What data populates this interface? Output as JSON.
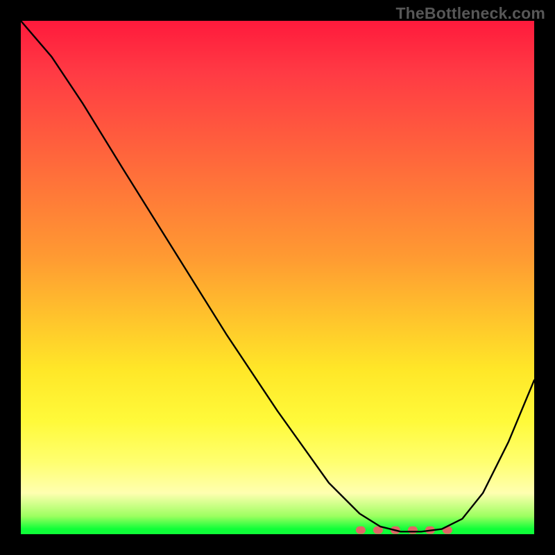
{
  "watermark": "TheBottleneck.com",
  "chart_data": {
    "type": "line",
    "title": "",
    "xlabel": "",
    "ylabel": "",
    "xlim": [
      0,
      100
    ],
    "ylim": [
      0,
      100
    ],
    "grid": false,
    "legend": false,
    "series": [
      {
        "name": "bottleneck-curve",
        "x": [
          0,
          6,
          12,
          20,
          30,
          40,
          50,
          60,
          66,
          70,
          74,
          78,
          82,
          86,
          90,
          95,
          100
        ],
        "values": [
          100,
          93,
          84,
          71,
          55,
          39,
          24,
          10,
          4,
          1.5,
          0.5,
          0.5,
          1,
          3,
          8,
          18,
          30
        ]
      }
    ],
    "annotations": [
      {
        "name": "optimal-flat-region",
        "x_start": 66,
        "x_end": 84,
        "color": "#e06666",
        "style": "dotted-thick"
      }
    ],
    "background_gradient": {
      "direction": "vertical",
      "stops": [
        {
          "pos": 0.0,
          "color": "#ff1a3c"
        },
        {
          "pos": 0.5,
          "color": "#ffb030"
        },
        {
          "pos": 0.8,
          "color": "#ffff60"
        },
        {
          "pos": 1.0,
          "color": "#0fff38"
        }
      ]
    }
  }
}
